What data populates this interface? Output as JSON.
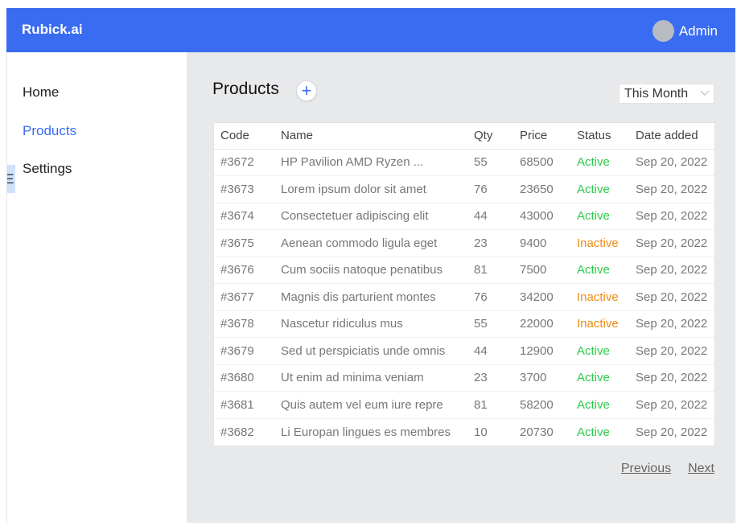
{
  "brand": "Rubick.ai",
  "user": {
    "name": "Admin"
  },
  "sidebar": {
    "edge_glyph": "E",
    "items": [
      {
        "label": "Home"
      },
      {
        "label": "Products"
      },
      {
        "label": "Settings"
      }
    ]
  },
  "page": {
    "title": "Products",
    "add_icon": "+"
  },
  "filter": {
    "selected": "This Month"
  },
  "table": {
    "headers": [
      "Code",
      "Name",
      "Qty",
      "Price",
      "Status",
      "Date added"
    ],
    "rows": [
      [
        "#3672",
        "HP Pavilion AMD Ryzen ...",
        "55",
        "68500",
        "Active",
        "Sep 20, 2022"
      ],
      [
        "#3673",
        "Lorem ipsum dolor sit amet",
        "76",
        "23650",
        "Active",
        "Sep 20, 2022"
      ],
      [
        "#3674",
        "Consectetuer adipiscing elit",
        "44",
        "43000",
        "Active",
        "Sep 20, 2022"
      ],
      [
        "#3675",
        "Aenean commodo ligula eget",
        "23",
        "9400",
        "Inactive",
        "Sep 20, 2022"
      ],
      [
        "#3676",
        "Cum sociis natoque penatibus",
        "81",
        "7500",
        "Active",
        "Sep 20, 2022"
      ],
      [
        "#3677",
        "Magnis dis parturient montes",
        "76",
        "34200",
        "Inactive",
        "Sep 20, 2022"
      ],
      [
        "#3678",
        "Nascetur ridiculus mus",
        "55",
        "22000",
        "Inactive",
        "Sep 20, 2022"
      ],
      [
        "#3679",
        "Sed ut perspiciatis unde omnis",
        "44",
        "12900",
        "Active",
        "Sep 20, 2022"
      ],
      [
        "#3680",
        "Ut enim ad minima veniam",
        "23",
        "3700",
        "Active",
        "Sep 20, 2022"
      ],
      [
        "#3681",
        "Quis autem vel eum iure repre",
        "81",
        "58200",
        "Active",
        "Sep 20, 2022"
      ],
      [
        "#3682",
        "Li Europan lingues es membres",
        "10",
        "20730",
        "Active",
        "Sep 20, 2022"
      ]
    ]
  },
  "pagination": {
    "previous": "Previous",
    "next": "Next"
  },
  "colors": {
    "header_bg": "#3a6cf2",
    "accent": "#3a6cf2",
    "status_active": "#2ec94b",
    "status_inactive": "#f08a12",
    "main_bg": "#e8e9eb"
  }
}
